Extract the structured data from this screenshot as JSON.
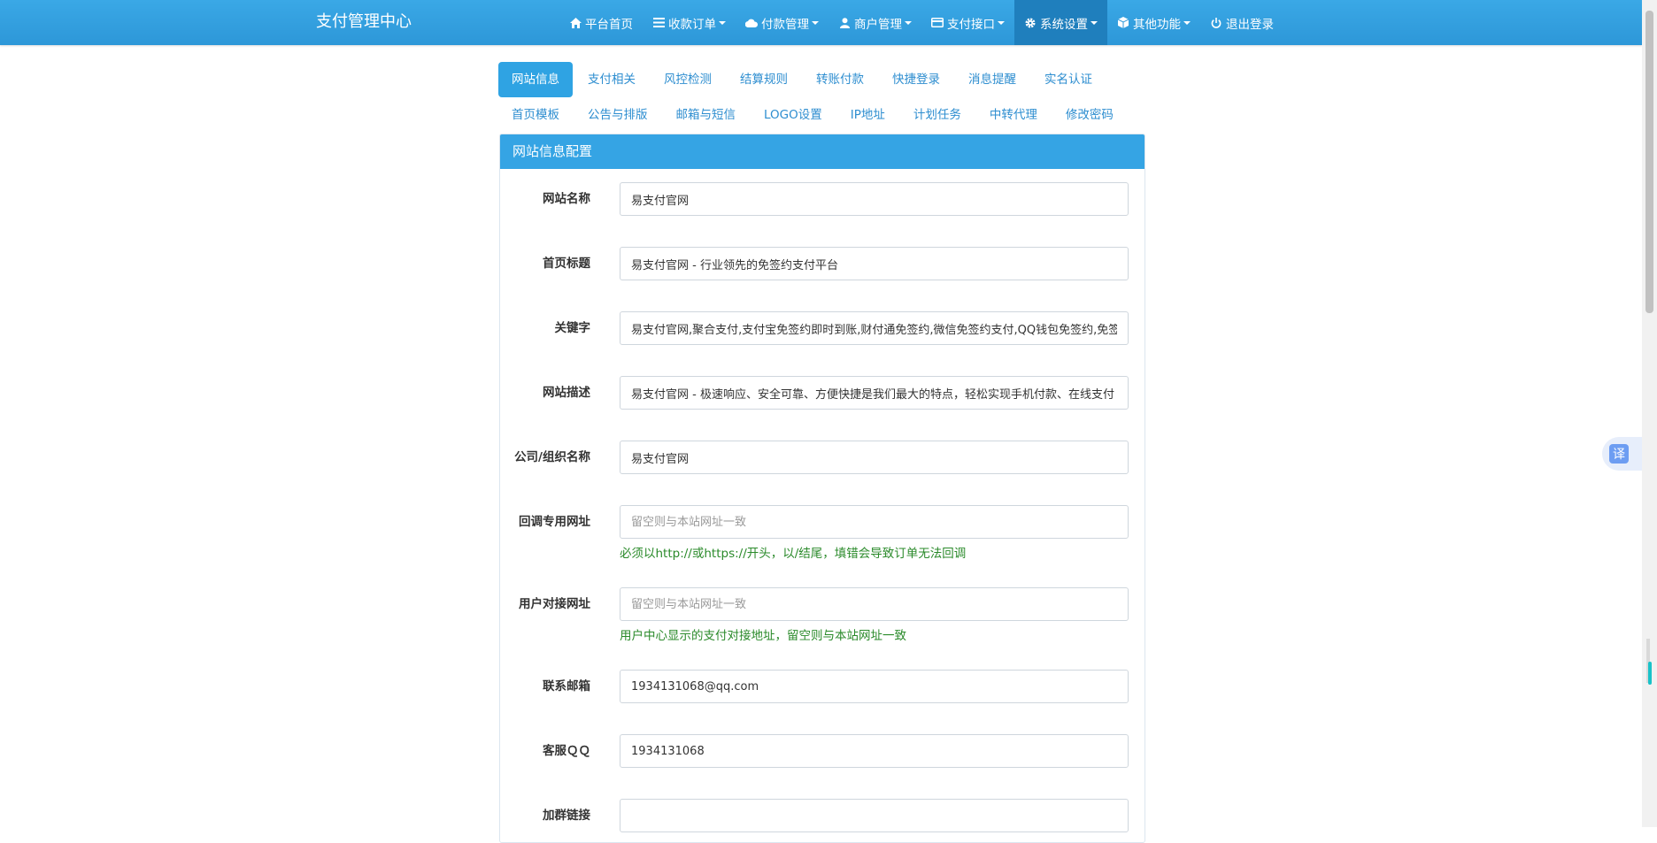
{
  "navbar": {
    "brand": "支付管理中心",
    "items": [
      {
        "label": "平台首页",
        "icon": "home-icon",
        "dropdown": false
      },
      {
        "label": "收款订单",
        "icon": "list-icon",
        "dropdown": true
      },
      {
        "label": "付款管理",
        "icon": "cloud-icon",
        "dropdown": true
      },
      {
        "label": "商户管理",
        "icon": "user-icon",
        "dropdown": true
      },
      {
        "label": "支付接口",
        "icon": "credit-card-icon",
        "dropdown": true
      },
      {
        "label": "系统设置",
        "icon": "gear-icon",
        "dropdown": true,
        "active": true
      },
      {
        "label": "其他功能",
        "icon": "cube-icon",
        "dropdown": true
      },
      {
        "label": "退出登录",
        "icon": "power-icon",
        "dropdown": false
      }
    ]
  },
  "tabs": {
    "row1": [
      "网站信息",
      "支付相关",
      "风控检测",
      "结算规则",
      "转账付款",
      "快捷登录",
      "消息提醒",
      "实名认证"
    ],
    "row2": [
      "首页模板",
      "公告与排版",
      "邮箱与短信",
      "LOGO设置",
      "IP地址",
      "计划任务",
      "中转代理",
      "修改密码"
    ],
    "active": "网站信息"
  },
  "panel": {
    "title": "网站信息配置",
    "fields": [
      {
        "label": "网站名称",
        "value": "易支付官网",
        "placeholder": ""
      },
      {
        "label": "首页标题",
        "value": "易支付官网 - 行业领先的免签约支付平台",
        "placeholder": ""
      },
      {
        "label": "关键字",
        "value": "易支付官网,聚合支付,支付宝免签约即时到账,财付通免签约,微信免签约支付,QQ钱包免签约,免签约支付",
        "placeholder": ""
      },
      {
        "label": "网站描述",
        "value": "易支付官网 - 极速响应、安全可靠、方便快捷是我们最大的特点，轻松实现手机付款、在线支付",
        "placeholder": ""
      },
      {
        "label": "公司/组织名称",
        "value": "易支付官网",
        "placeholder": ""
      },
      {
        "label": "回调专用网址",
        "value": "",
        "placeholder": "留空则与本站网址一致",
        "help": "必须以http://或https://开头，以/结尾，填错会导致订单无法回调"
      },
      {
        "label": "用户对接网址",
        "value": "",
        "placeholder": "留空则与本站网址一致",
        "help": "用户中心显示的支付对接地址，留空则与本站网址一致"
      },
      {
        "label": "联系邮箱",
        "value": "1934131068@qq.com",
        "placeholder": ""
      },
      {
        "label": "客服ＱＱ",
        "value": "1934131068",
        "placeholder": ""
      },
      {
        "label": "加群链接",
        "value": "",
        "placeholder": ""
      }
    ]
  },
  "translate": {
    "label": "译"
  },
  "colors": {
    "navbar": "#2d97d8",
    "accent": "#35a4e4",
    "help_text": "#2a8a2a",
    "tab_link": "#2e8ed0"
  }
}
